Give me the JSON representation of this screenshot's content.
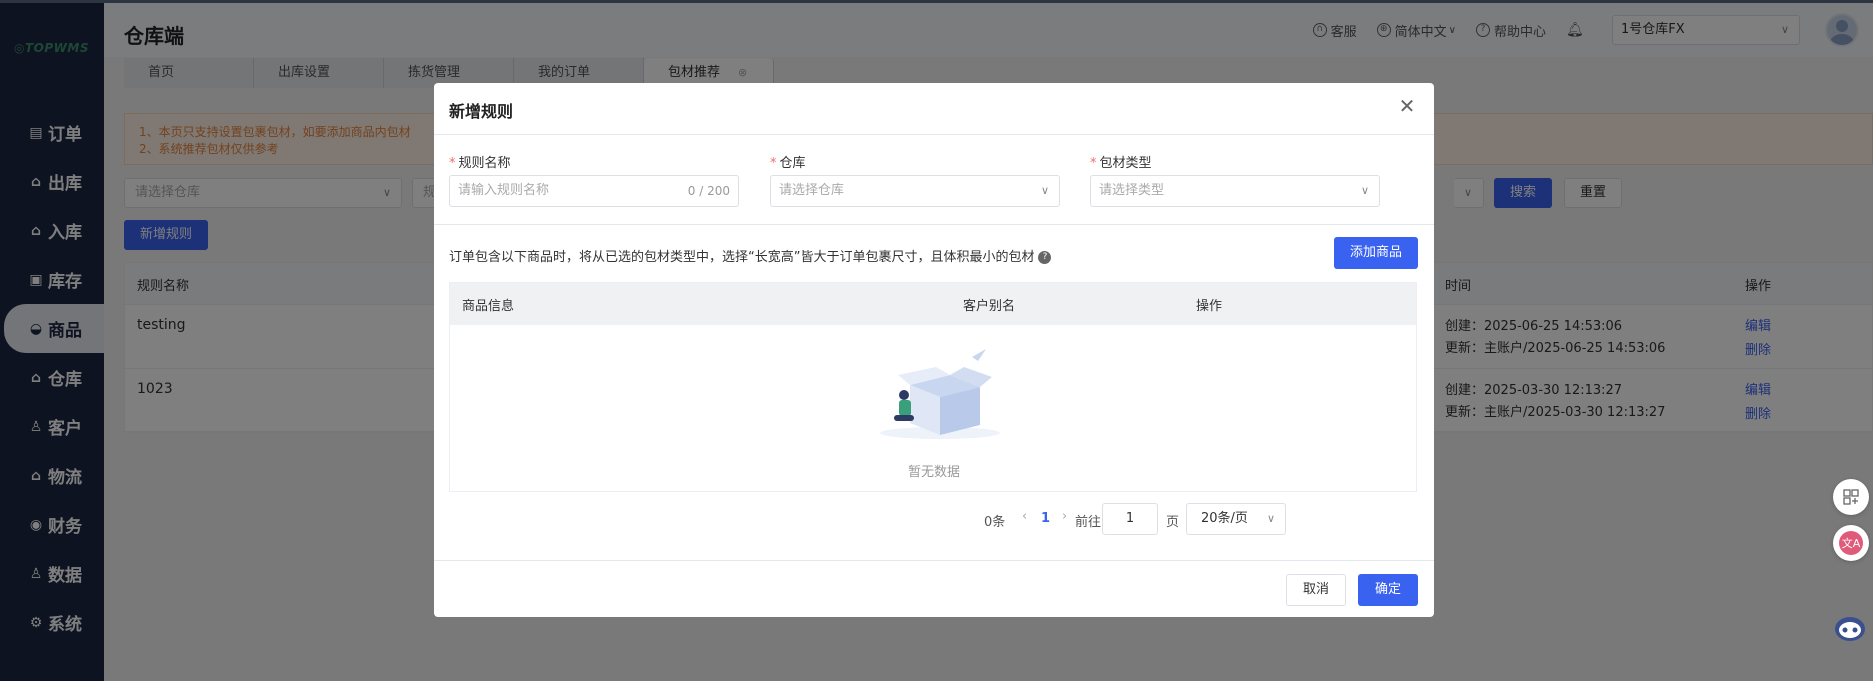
{
  "sidebar": {
    "logo": "TOPWMS",
    "items": [
      {
        "label": "订单",
        "icon": "order-icon"
      },
      {
        "label": "出库",
        "icon": "outbound-icon"
      },
      {
        "label": "入库",
        "icon": "inbound-icon"
      },
      {
        "label": "库存",
        "icon": "inventory-icon"
      },
      {
        "label": "商品",
        "icon": "goods-icon"
      },
      {
        "label": "仓库",
        "icon": "warehouse-icon"
      },
      {
        "label": "客户",
        "icon": "customer-icon"
      },
      {
        "label": "物流",
        "icon": "logistics-icon"
      },
      {
        "label": "财务",
        "icon": "finance-icon"
      },
      {
        "label": "数据",
        "icon": "data-icon"
      },
      {
        "label": "系统",
        "icon": "settings-icon"
      }
    ]
  },
  "header": {
    "title": "仓库端",
    "service": "客服",
    "language": "简体中文",
    "help": "帮助中心",
    "warehouse": "1号仓库FX"
  },
  "tabs": [
    {
      "label": "首页"
    },
    {
      "label": "出库设置"
    },
    {
      "label": "拣货管理"
    },
    {
      "label": "我的订单"
    },
    {
      "label": "包材推荐"
    }
  ],
  "notice": {
    "line1": "1、本页只支持设置包裹包材，如要添加商品内包材",
    "line2": "2、系统推荐包材仅供参考"
  },
  "filter": {
    "warehouse_placeholder": "请选择仓库",
    "second_placeholder": "规",
    "search": "搜索",
    "reset": "重置"
  },
  "add_rule_button": "新增规则",
  "main_table": {
    "headers": {
      "name": "规则名称",
      "time": "时间",
      "ops": "操作"
    },
    "rows": [
      {
        "name": "testing",
        "created": "创建：2025-06-25 14:53:06",
        "updated": "更新：主账户/2025-06-25 14:53:06",
        "edit": "编辑",
        "delete": "删除"
      },
      {
        "name": "1023",
        "created": "创建：2025-03-30 12:13:27",
        "updated": "更新：主账户/2025-03-30 12:13:27",
        "edit": "编辑",
        "delete": "删除"
      }
    ]
  },
  "modal": {
    "title": "新增规则",
    "fields": {
      "name_label": "规则名称",
      "name_placeholder": "请输入规则名称",
      "name_count": "0 / 200",
      "warehouse_label": "仓库",
      "warehouse_placeholder": "请选择仓库",
      "type_label": "包材类型",
      "type_placeholder": "请选择类型"
    },
    "description": "订单包含以下商品时，将从已选的包材类型中，选择“长宽高”皆大于订单包裹尺寸，且体积最小的包材",
    "add_goods": "添加商品",
    "table_headers": {
      "info": "商品信息",
      "alias": "客户别名",
      "ops": "操作"
    },
    "empty": "暂无数据",
    "pager": {
      "total": "0条",
      "current": "1",
      "goto": "前往",
      "page_value": "1",
      "page": "页",
      "size": "20条/页"
    },
    "cancel": "取消",
    "confirm": "确定"
  }
}
